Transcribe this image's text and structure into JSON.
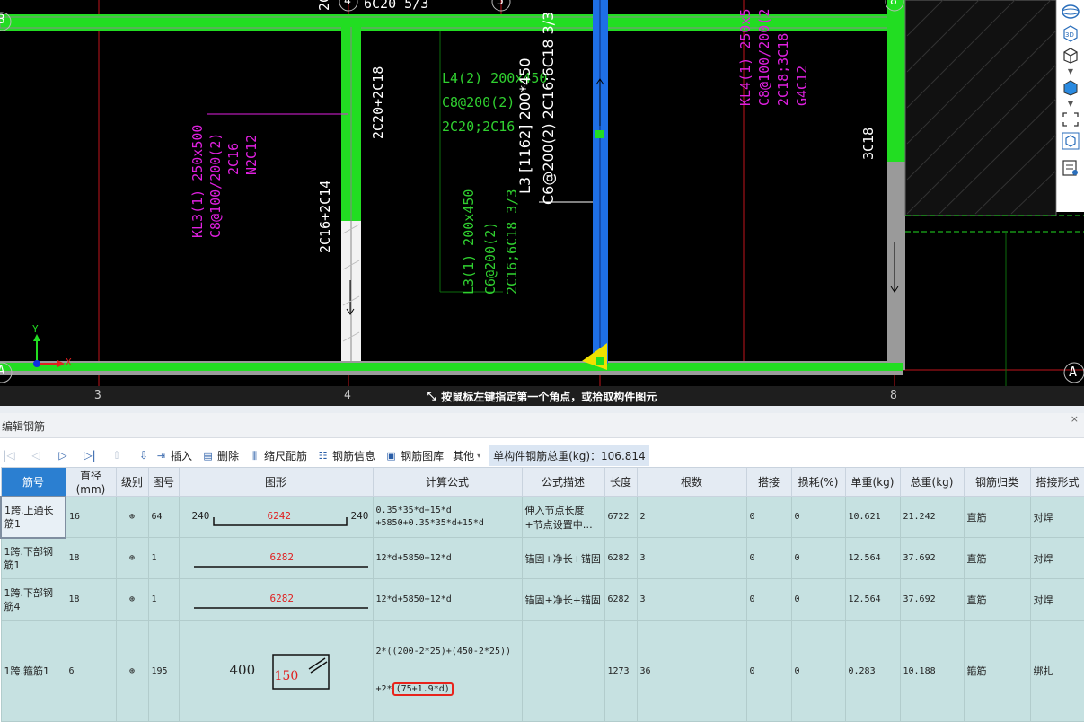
{
  "canvas": {
    "axis_labels": {
      "col_3": "3",
      "col_4": "4",
      "col_5": "5",
      "col_8": "8",
      "row_A_left": "A",
      "row_A_right": "A",
      "row_B": "B"
    },
    "annotations": {
      "kl3_line1": "KL3(1) 250x500",
      "kl3_line2": "C8@100/200(2)",
      "kl3_line3": "2C16",
      "kl3_line4": "N2C12",
      "beam4_top": "2C20+2C18",
      "beam4_bottom": "2C16+2C14",
      "top_6c20": "6C20 5/3",
      "l4_line1": "L4(2) 200x450",
      "l4_line2": "C8@200(2)",
      "l4_line3": "2C20;2C16",
      "l3_line1": "L3(1) 200x450",
      "l3_line2": "C6@200(2)",
      "l3_line3": "2C16;6C18  3/3",
      "white_label_1": "L3 [1162] 200*450",
      "white_label_2": "C6@200(2) 2C16;6C18 3/3",
      "kl4_line1": "KL4(1) 250x5",
      "kl4_line2": "C8@100/200(2",
      "kl4_line3": "2C18;3C18",
      "kl4_line4": "G4C12",
      "col8_3c18": "3C18",
      "top_2c": "2C"
    },
    "axis_x_label": "X",
    "axis_y_label": "Y"
  },
  "right_toolbar": {
    "icons": [
      "sphere-icon",
      "3d-icon",
      "cube-icon",
      "cube-filled-icon",
      "fit-frame-icon",
      "view-cube-icon",
      "list-settings-icon"
    ],
    "label_3d": "3D"
  },
  "status_bar": {
    "message": "按鼠标左键指定第一个角点，或拾取构件图元"
  },
  "panel": {
    "title": "编辑钢筋",
    "close": "×"
  },
  "toolbar": {
    "insert": "插入",
    "delete": "删除",
    "scale": "缩尺配筋",
    "rebar_info": "钢筋信息",
    "rebar_library": "钢筋图库",
    "other": "其他",
    "total_weight": "单构件钢筋总重(kg)：106.814"
  },
  "table": {
    "headers": [
      "筋号",
      "直径(mm)",
      "级别",
      "图号",
      "图形",
      "计算公式",
      "公式描述",
      "长度",
      "根数",
      "搭接",
      "损耗(%)",
      "单重(kg)",
      "总重(kg)",
      "钢筋归类",
      "搭接形式"
    ],
    "rows": [
      {
        "name": "1跨.上通长筋1",
        "diameter": "16",
        "grade": "⊕",
        "fig_no": "64",
        "shape": {
          "left": "240",
          "mid": "6242",
          "right": "240"
        },
        "formula_line1": "0.35*35*d+15*d",
        "formula_line2": "+5850+0.35*35*d+15*d",
        "desc_line1": "伸入节点长度",
        "desc_line2": "+节点设置中…",
        "length": "6722",
        "count": "2",
        "lap": "0",
        "loss": "0",
        "unit_weight": "10.621",
        "total_weight": "21.242",
        "category": "直筋",
        "lap_type": "对焊"
      },
      {
        "name": "1跨.下部钢筋1",
        "diameter": "18",
        "grade": "⊕",
        "fig_no": "1",
        "shape": {
          "mid": "6282"
        },
        "formula_line1": "12*d+5850+12*d",
        "desc_line1": "锚固+净长+锚固",
        "length": "6282",
        "count": "3",
        "lap": "0",
        "loss": "0",
        "unit_weight": "12.564",
        "total_weight": "37.692",
        "category": "直筋",
        "lap_type": "对焊"
      },
      {
        "name": "1跨.下部钢筋4",
        "diameter": "18",
        "grade": "⊕",
        "fig_no": "1",
        "shape": {
          "mid": "6282"
        },
        "formula_line1": "12*d+5850+12*d",
        "desc_line1": "锚固+净长+锚固",
        "length": "6282",
        "count": "3",
        "lap": "0",
        "loss": "0",
        "unit_weight": "12.564",
        "total_weight": "37.692",
        "category": "直筋",
        "lap_type": "对焊"
      },
      {
        "name": "1跨.箍筋1",
        "diameter": "6",
        "grade": "⊕",
        "fig_no": "195",
        "shape": {
          "left": "400",
          "inner": "150"
        },
        "formula_line1": "2*((200-2*25)+(450-2*25))",
        "formula_line2_prefix": "+2*",
        "formula_line2_box": "(75+1.9*d)",
        "desc_line1": "",
        "length": "1273",
        "count": "36",
        "lap": "0",
        "loss": "0",
        "unit_weight": "0.283",
        "total_weight": "10.188",
        "category": "箍筋",
        "lap_type": "绑扎"
      }
    ]
  },
  "colors": {
    "beam_green": "#22dd22",
    "column_blue": "#1e6fe6",
    "grid_red": "#c0141c",
    "magenta_text": "#e020e0",
    "green_text": "#30d030",
    "table_row": "#c6e1e1",
    "header_selected": "#2b7fd1",
    "highlight_red": "#e8241c"
  }
}
